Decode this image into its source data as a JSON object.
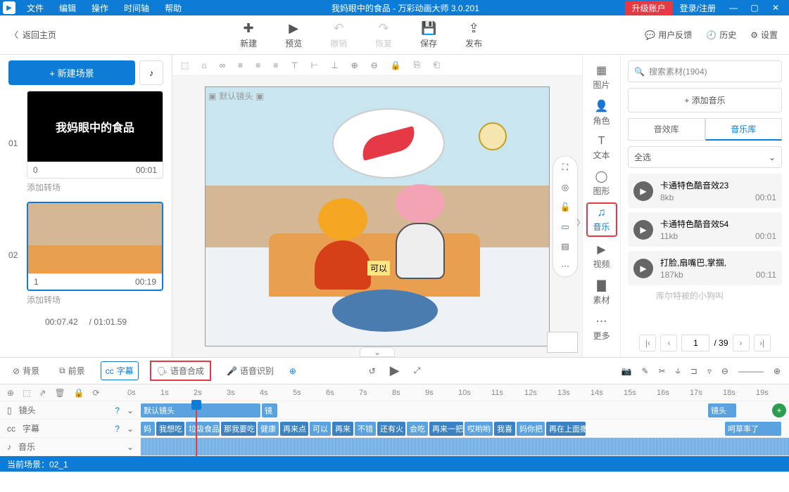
{
  "titlebar": {
    "menus": [
      "文件",
      "编辑",
      "操作",
      "时间轴",
      "帮助"
    ],
    "title": "我妈眼中的食品 - 万彩动画大师 3.0.201",
    "upgrade": "升级账户",
    "login": "登录/注册"
  },
  "back_home": "返回主页",
  "toolbar": {
    "new": "新建",
    "preview": "预览",
    "undo": "撤销",
    "redo": "恢复",
    "save": "保存",
    "publish": "发布",
    "feedback": "用户反馈",
    "history": "历史",
    "settings": "设置"
  },
  "left": {
    "new_scene": "+ 新建场景",
    "scene1_title": "我妈眼中的食品",
    "scene1_idx": "0",
    "scene1_time": "00:01",
    "transition": "添加转场",
    "scene2_idx": "1",
    "scene2_time": "00:19",
    "num1": "01",
    "num2": "02",
    "cur_time": "00:07.42",
    "total_time": "/ 01:01.59"
  },
  "stage_label": "默认镜头",
  "caption": "可以",
  "categories": {
    "image": "图片",
    "role": "角色",
    "text": "文本",
    "shape": "图形",
    "music": "音乐",
    "video": "视频",
    "material": "素材",
    "more": "更多"
  },
  "right": {
    "search_placeholder": "搜索素材(1904)",
    "add_music": "+ 添加音乐",
    "tab_sfx": "音效库",
    "tab_music": "音乐库",
    "select_all": "全选",
    "items": [
      {
        "name": "卡通特色酷音效23",
        "size": "8kb",
        "dur": "00:01"
      },
      {
        "name": "卡通特色酷音效54",
        "size": "11kb",
        "dur": "00:01"
      },
      {
        "name": "打脸,扇嘴巴,掌掴,",
        "size": "187kb",
        "dur": "00:11"
      }
    ],
    "truncated": "库尔特被的小狗叫",
    "page": "1",
    "pages": "/ 39"
  },
  "tl_tabs": {
    "bg": "背景",
    "fg": "前景",
    "subtitle": "字幕",
    "tts": "语音合成",
    "asr": "语音识别"
  },
  "ruler": [
    "0s",
    "1s",
    "2s",
    "3s",
    "4s",
    "5s",
    "6s",
    "7s",
    "8s",
    "9s",
    "10s",
    "11s",
    "12s",
    "13s",
    "14s",
    "15s",
    "16s",
    "17s",
    "18s",
    "19s"
  ],
  "tracks": {
    "camera": "镜头",
    "subtitle": "字幕",
    "music": "音乐",
    "cam_clip1": "默认镜头",
    "cam_clip2": "镜",
    "cam_clip3": "镜头",
    "subs": [
      "妈",
      "我想吃",
      "垃圾食品",
      "那我要吃",
      "健康",
      "再来点",
      "可以",
      "再来",
      "不错",
      "还有火",
      "会吃",
      "再来一把",
      "哎哟哟",
      "我喜",
      "妈你把",
      "再在上面撒",
      "呵草率了"
    ]
  },
  "status": "当前场景：02_1"
}
